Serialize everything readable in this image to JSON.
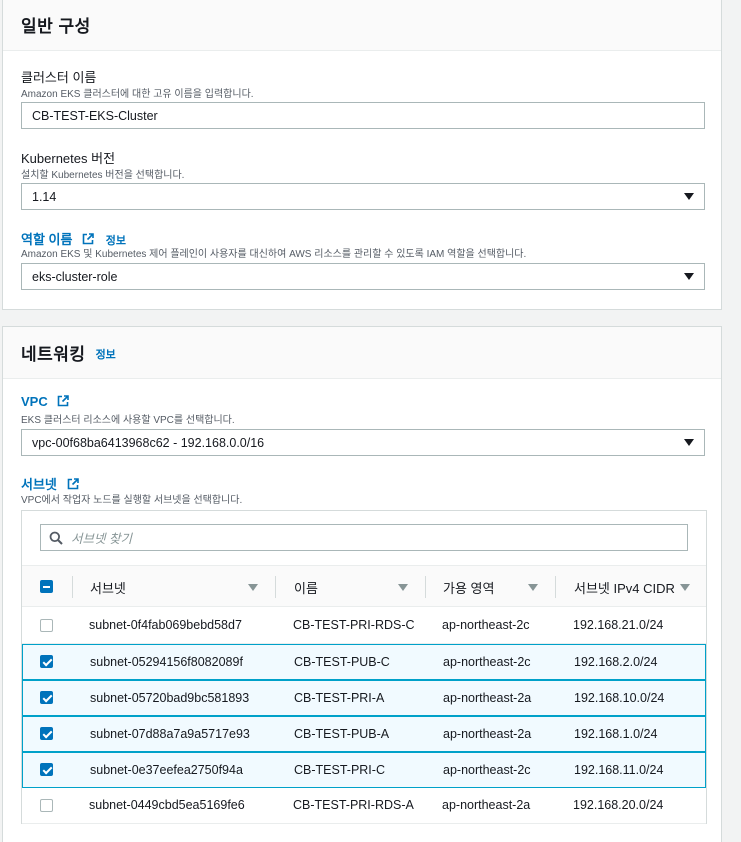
{
  "general": {
    "title": "일반 구성",
    "cluster_name": {
      "label": "클러스터 이름",
      "desc": "Amazon EKS 클러스터에 대한 고유 이름을 입력합니다.",
      "value": "CB-TEST-EKS-Cluster"
    },
    "k8s_version": {
      "label": "Kubernetes 버전",
      "desc": "설치할 Kubernetes 버전을 선택합니다.",
      "value": "1.14"
    },
    "role": {
      "label": "역할 이름",
      "info": "정보",
      "desc": "Amazon EKS 및 Kubernetes 제어 플레인이 사용자를 대신하여 AWS 리소스를 관리할 수 있도록 IAM 역할을 선택합니다.",
      "value": "eks-cluster-role"
    }
  },
  "networking": {
    "title": "네트워킹",
    "info": "정보",
    "vpc": {
      "label": "VPC",
      "desc": "EKS 클러스터 리소스에 사용할 VPC를 선택합니다.",
      "value": "vpc-00f68ba6413968c62 - 192.168.0.0/16"
    },
    "subnets": {
      "label": "서브넷",
      "desc": "VPC에서 작업자 노드를 실행할 서브넷을 선택합니다.",
      "search_placeholder": "서브넷 찾기",
      "columns": [
        "서브넷",
        "이름",
        "가용 영역",
        "서브넷 IPv4 CIDR"
      ],
      "rows": [
        {
          "id": "subnet-0f4fab069bebd58d7",
          "name": "CB-TEST-PRI-RDS-C",
          "az": "ap-northeast-2c",
          "cidr": "192.168.21.0/24",
          "selected": false
        },
        {
          "id": "subnet-05294156f8082089f",
          "name": "CB-TEST-PUB-C",
          "az": "ap-northeast-2c",
          "cidr": "192.168.2.0/24",
          "selected": true
        },
        {
          "id": "subnet-05720bad9bc581893",
          "name": "CB-TEST-PRI-A",
          "az": "ap-northeast-2a",
          "cidr": "192.168.10.0/24",
          "selected": true
        },
        {
          "id": "subnet-07d88a7a9a5717e93",
          "name": "CB-TEST-PUB-A",
          "az": "ap-northeast-2a",
          "cidr": "192.168.1.0/24",
          "selected": true
        },
        {
          "id": "subnet-0e37eefea2750f94a",
          "name": "CB-TEST-PRI-C",
          "az": "ap-northeast-2c",
          "cidr": "192.168.11.0/24",
          "selected": true
        },
        {
          "id": "subnet-0449cbd5ea5169fe6",
          "name": "CB-TEST-PRI-RDS-A",
          "az": "ap-northeast-2a",
          "cidr": "192.168.20.0/24",
          "selected": false
        }
      ]
    }
  },
  "colors": {
    "link": "#0073bb",
    "selected_row_bg": "#f1faff",
    "selected_row_border": "#00a1c9"
  }
}
